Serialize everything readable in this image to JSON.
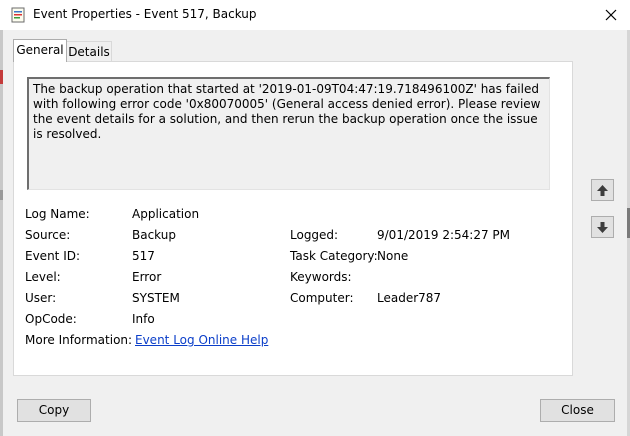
{
  "window": {
    "title": "Event Properties - Event 517, Backup",
    "app_icon": "event-properties-icon",
    "close_icon": "close-icon"
  },
  "tabs": [
    {
      "label": "General",
      "selected": true
    },
    {
      "label": "Details",
      "selected": false
    }
  ],
  "description": "The backup operation that started at '2019-01-09T04:47:19.718496100Z' has failed with following error code '0x80070005' (General access denied error). Please review the event details for a solution, and then rerun the backup operation once the issue is resolved.",
  "fields": {
    "log_name": {
      "label": "Log Name:",
      "value": "Application"
    },
    "source": {
      "label": "Source:",
      "value": "Backup"
    },
    "event_id": {
      "label": "Event ID:",
      "value": "517"
    },
    "level": {
      "label": "Level:",
      "value": "Error"
    },
    "user": {
      "label": "User:",
      "value": "SYSTEM"
    },
    "opcode": {
      "label": "OpCode:",
      "value": "Info"
    },
    "more_info": {
      "label": "More Information:",
      "value": "Event Log Online Help"
    },
    "logged": {
      "label": "Logged:",
      "value": "9/01/2019 2:54:27 PM"
    },
    "task_category": {
      "label": "Task Category:",
      "value": "None"
    },
    "keywords": {
      "label": "Keywords:",
      "value": ""
    },
    "computer": {
      "label": "Computer:",
      "value": "Leader787"
    }
  },
  "nav": {
    "up_icon": "arrow-up-icon",
    "down_icon": "arrow-down-icon"
  },
  "buttons": {
    "copy": "Copy",
    "close": "Close"
  }
}
